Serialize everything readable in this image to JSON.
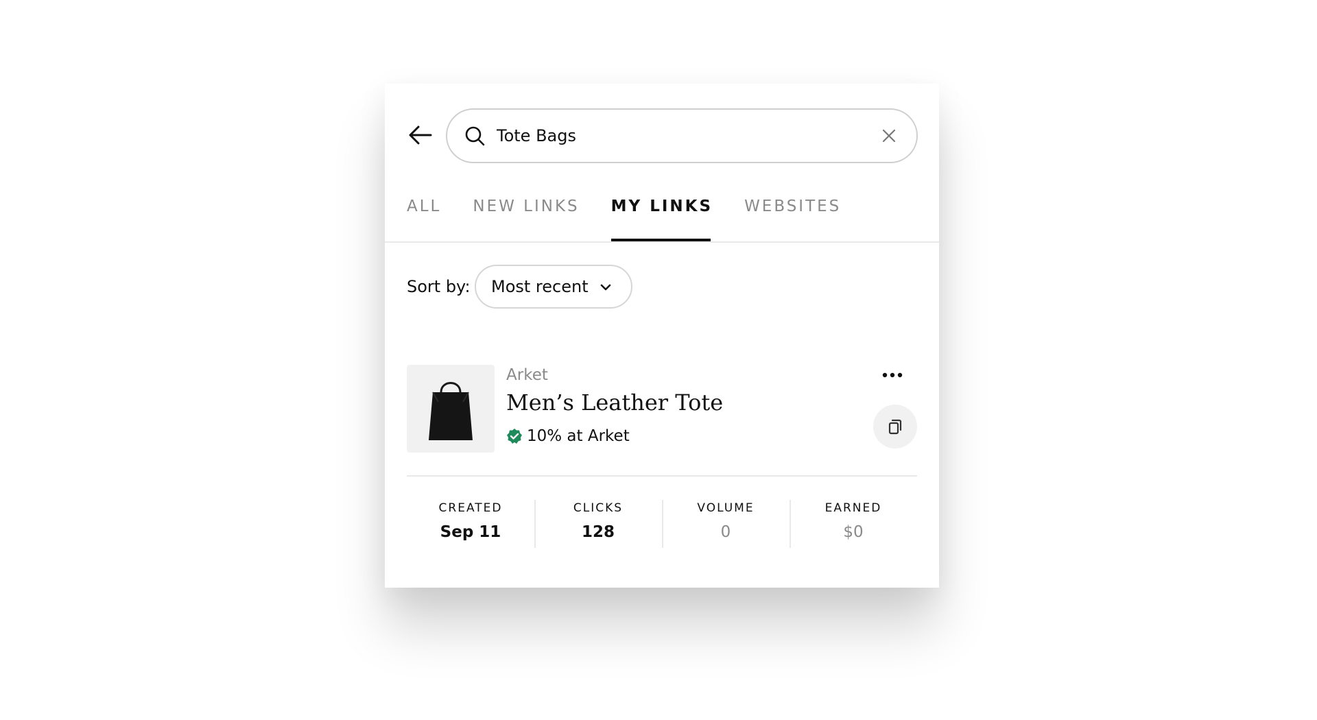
{
  "search": {
    "value": "Tote Bags"
  },
  "tabs": [
    {
      "label": "ALL"
    },
    {
      "label": "NEW LINKS"
    },
    {
      "label": "MY LINKS"
    },
    {
      "label": "WEBSITES"
    }
  ],
  "active_tab": "MY LINKS",
  "sort": {
    "label": "Sort by:",
    "value": "Most recent"
  },
  "item": {
    "brand": "Arket",
    "name": "Men’s Leather Tote",
    "commission": "10% at Arket",
    "verified_color": "#1f8a5a"
  },
  "stats": [
    {
      "label": "CREATED",
      "value": "Sep 11"
    },
    {
      "label": "CLICKS",
      "value": "128"
    },
    {
      "label": "VOLUME",
      "value": "0"
    },
    {
      "label": "EARNED",
      "value": "$0"
    }
  ],
  "icons": [
    "arrow-left-icon",
    "search-icon",
    "close-icon",
    "chevron-down-icon",
    "tote-bag-image",
    "verified-check-icon",
    "more-horizontal-icon",
    "copy-icon"
  ]
}
